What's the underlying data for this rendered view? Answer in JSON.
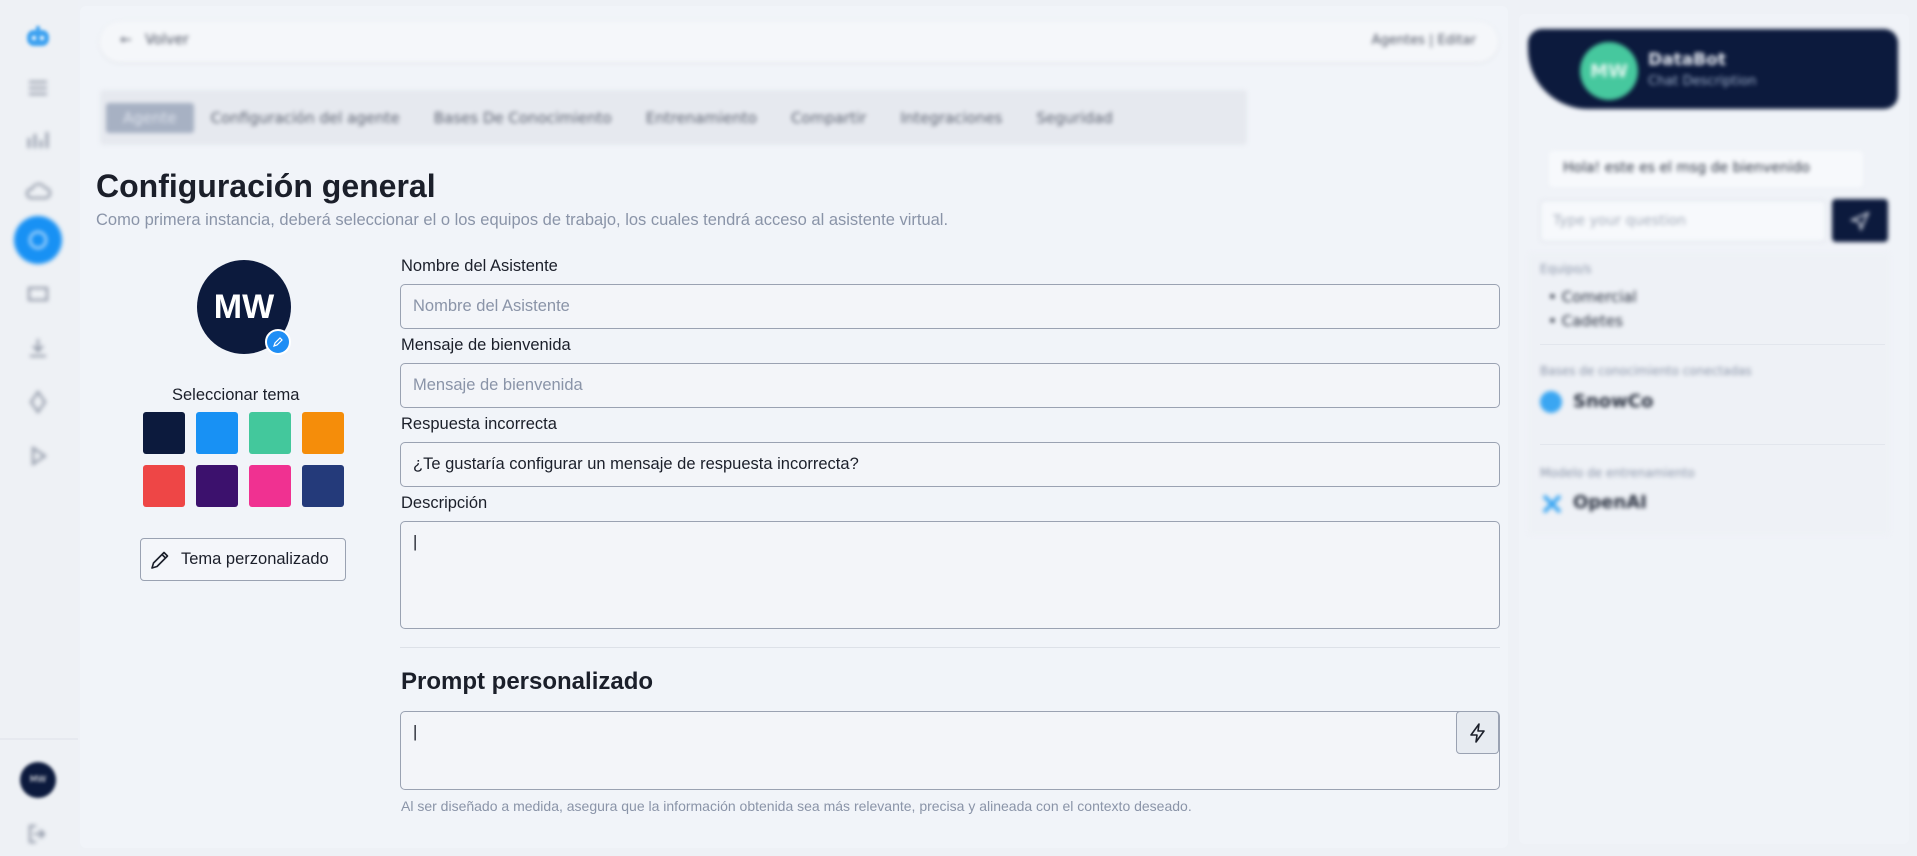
{
  "rail": {
    "icons": [
      "chatbot-logo-icon",
      "menu-lines-icon",
      "chart-icon",
      "cloud-icon",
      "globe-icon",
      "grid-icon",
      "download-icon",
      "diamond-icon",
      "play-icon"
    ],
    "user_initials": "MW"
  },
  "topbar": {
    "back_label": "Volver",
    "crumbs": "Agentes  |  Editar"
  },
  "tabs": [
    {
      "label": "Agente",
      "active": true
    },
    {
      "label": "Configuración del agente"
    },
    {
      "label": "Bases De Conocimiento"
    },
    {
      "label": "Entrenamiento"
    },
    {
      "label": "Compartir"
    },
    {
      "label": "Integraciones"
    },
    {
      "label": "Seguridad"
    }
  ],
  "general": {
    "title": "Configuración general",
    "subtitle": "Como primera instancia, deberá seleccionar el o los equipos de trabajo, los cuales tendrá acceso al asistente virtual."
  },
  "avatar": {
    "initials": "MW"
  },
  "theme": {
    "label": "Seleccionar tema",
    "colors": [
      "#0c1a3d",
      "#1891f4",
      "#43c89c",
      "#f58d0a",
      "#ee4646",
      "#3c116d",
      "#f03191",
      "#243a7a"
    ],
    "custom_label": "Tema perzonalizado"
  },
  "form": {
    "name_label": "Nombre del Asistente",
    "name_placeholder": "Nombre del Asistente",
    "welcome_label": "Mensaje de bienvenida",
    "welcome_placeholder": "Mensaje de bienvenida",
    "wrong_label": "Respuesta incorrecta",
    "wrong_value": "¿Te gustaría configurar un mensaje de respuesta incorrecta?",
    "desc_label": "Descripción",
    "desc_value": "|"
  },
  "prompt": {
    "title": "Prompt personalizado",
    "value": "|",
    "hint": "Al ser diseñado a medida, asegura que la información obtenida sea más relevante, precisa y alineada con el contexto deseado."
  },
  "preview": {
    "initials": "MW",
    "name": "DataBot",
    "description": "Chat Description",
    "welcome_bubble": "Hola! este es el msg de bienvenido",
    "input_placeholder": "Type your question",
    "teams_label": "Equipo/s",
    "teams": [
      "Comercial",
      "Cadetes"
    ],
    "kb_label": "Bases de conocimiento conectadas",
    "kb_name": "SnowCo",
    "model_label": "Modelo de entrenamiento",
    "model_name": "OpenAI"
  }
}
